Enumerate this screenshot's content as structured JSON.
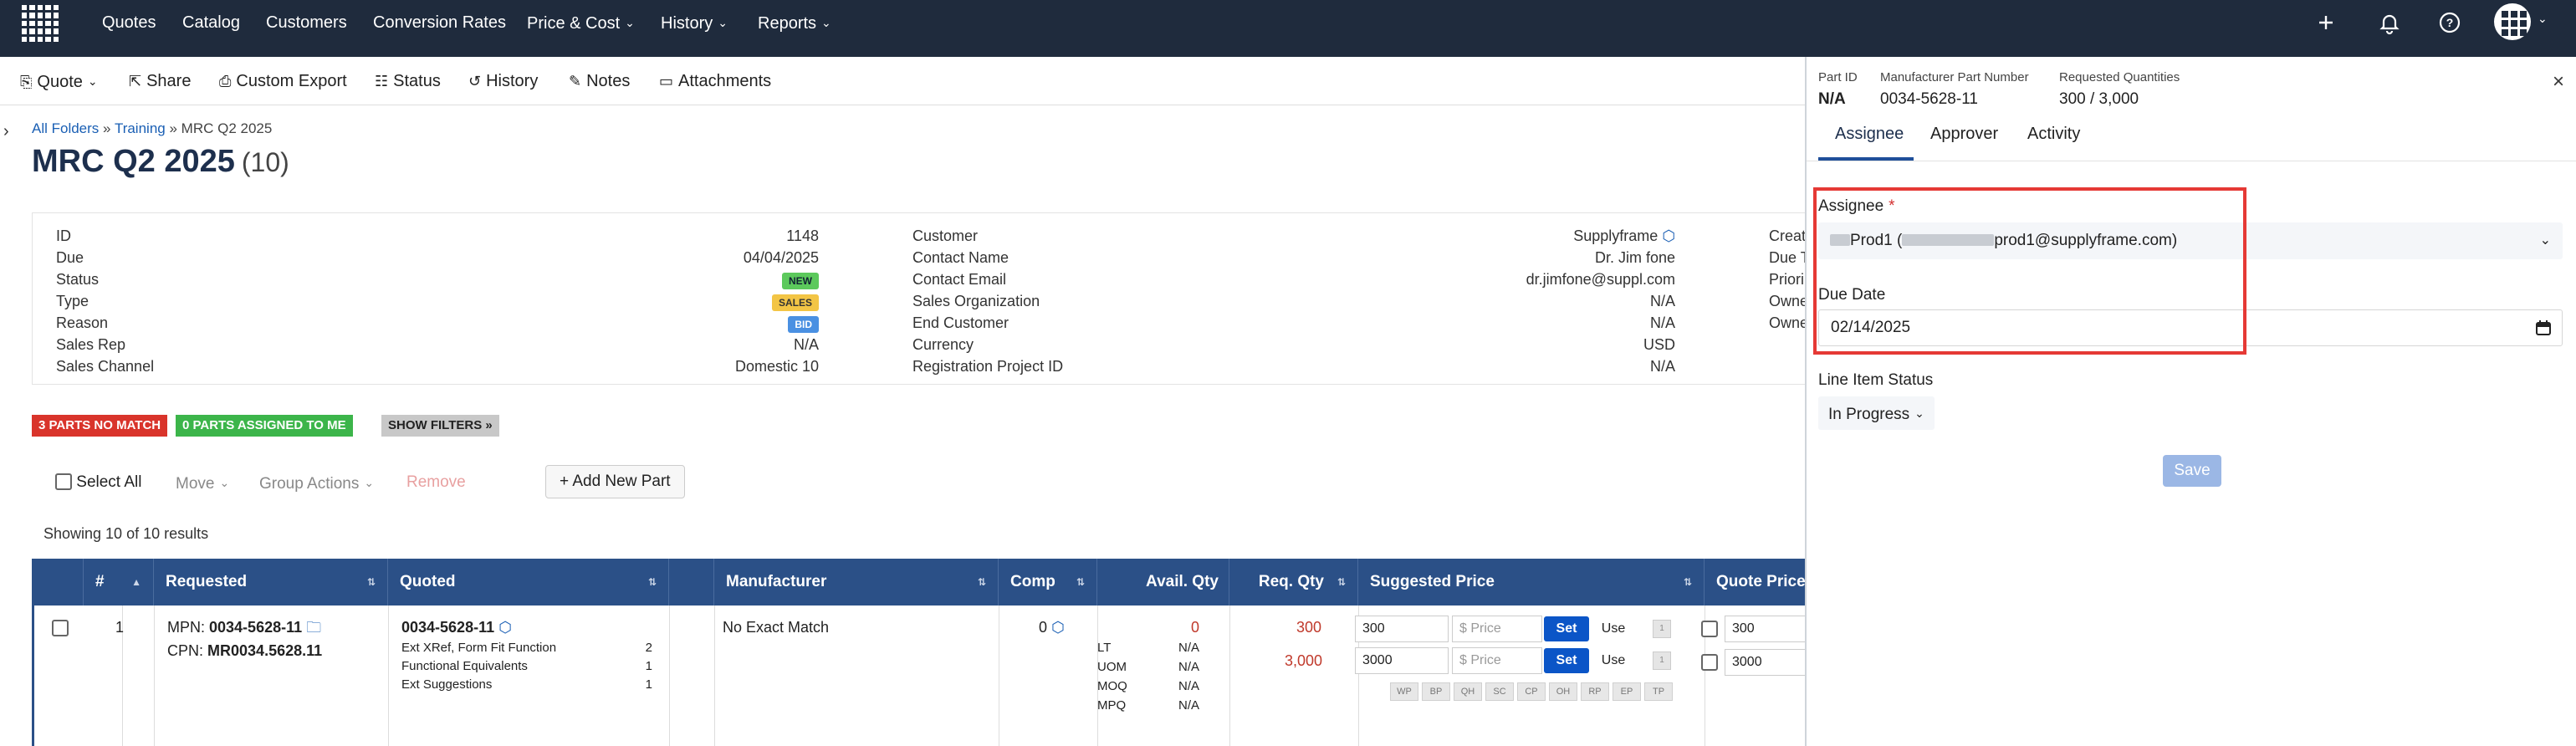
{
  "topnav": {
    "items": [
      "Quotes",
      "Catalog",
      "Customers",
      "Conversion Rates",
      "Price & Cost",
      "History",
      "Reports"
    ],
    "icons": [
      "plus-icon",
      "bell-icon",
      "help-icon",
      "apps-icon"
    ]
  },
  "toolbar": {
    "quote": "Quote",
    "share": "Share",
    "custom_export": "Custom Export",
    "status": "Status",
    "history": "History",
    "notes": "Notes",
    "attachments": "Attachments"
  },
  "breadcrumb": {
    "all_folders": "All Folders",
    "sep": "»",
    "training": "Training",
    "current": "MRC Q2 2025"
  },
  "title": {
    "name": "MRC Q2 2025",
    "count": "(10)"
  },
  "info": {
    "col1": [
      {
        "k": "ID",
        "v": "1148"
      },
      {
        "k": "Due",
        "v": "04/04/2025"
      },
      {
        "k": "Status",
        "v": "NEW"
      },
      {
        "k": "Type",
        "v": "SALES"
      },
      {
        "k": "Reason",
        "v": "BID"
      },
      {
        "k": "Sales Rep",
        "v": "N/A"
      },
      {
        "k": "Sales Channel",
        "v": "Domestic 10"
      }
    ],
    "col2": [
      {
        "k": "Customer",
        "v": "Supplyframe"
      },
      {
        "k": "Contact Name",
        "v": "Dr. Jim fone"
      },
      {
        "k": "Contact Email",
        "v": "dr.jimfone@suppl.com"
      },
      {
        "k": "Sales Organization",
        "v": "N/A"
      },
      {
        "k": "End Customer",
        "v": "N/A"
      },
      {
        "k": "Currency",
        "v": "USD"
      },
      {
        "k": "Registration Project ID",
        "v": "N/A"
      }
    ],
    "col3": [
      "Creat",
      "Due T",
      "Priori",
      "Owne",
      "Owne"
    ]
  },
  "filters": {
    "no_match": "3 PARTS NO MATCH",
    "assigned": "0 PARTS ASSIGNED TO ME",
    "show_filters": "SHOW FILTERS »"
  },
  "actions": {
    "select_all": "Select All",
    "move": "Move",
    "group_actions": "Group Actions",
    "remove": "Remove",
    "add_new_part": "+ Add New Part"
  },
  "showing": "Showing 10 of 10 results",
  "table": {
    "headers": [
      "#",
      "Requested",
      "Quoted",
      "",
      "Manufacturer",
      "Comp",
      "Avail. Qty",
      "Req. Qty",
      "Suggested Price",
      "Quote Price"
    ],
    "row": {
      "num": "1",
      "mpn_label": "MPN:",
      "mpn": "0034-5628-11",
      "cpn_label": "CPN:",
      "cpn": "MR0034.5628.11",
      "quoted": "0034-5628-11",
      "quoted_lines": [
        {
          "k": "Ext XRef, Form Fit Function",
          "v": "2"
        },
        {
          "k": "Functional Equivalents",
          "v": "1"
        },
        {
          "k": "Ext Suggestions",
          "v": "1"
        }
      ],
      "manufacturer": "No Exact Match",
      "comp": "0",
      "avail_qty": "0",
      "avail_lines": [
        {
          "k": "LT",
          "v": "N/A"
        },
        {
          "k": "UOM",
          "v": "N/A"
        },
        {
          "k": "MOQ",
          "v": "N/A"
        },
        {
          "k": "MPQ",
          "v": "N/A"
        }
      ],
      "req_qty": [
        "300",
        "3,000"
      ],
      "suggested": [
        {
          "qty": "300",
          "price_placeholder": "$ Price",
          "set": "Set",
          "use": "Use"
        },
        {
          "qty": "3000",
          "price_placeholder": "$ Price",
          "set": "Set",
          "use": "Use"
        }
      ],
      "price_tags": [
        "WP",
        "BP",
        "QH",
        "SC",
        "CP",
        "OH",
        "RP",
        "EP",
        "TP"
      ],
      "quote_price": [
        "300",
        "3000"
      ]
    }
  },
  "panel": {
    "part_id_label": "Part ID",
    "part_id": "N/A",
    "mpn_label": "Manufacturer Part Number",
    "mpn": "0034-5628-11",
    "req_qty_label": "Requested Quantities",
    "req_qty": "300 / 3,000",
    "tabs": [
      "Assignee",
      "Approver",
      "Activity"
    ],
    "assignee_label": "Assignee",
    "required_mark": "*",
    "assignee_value_a": "Prod1 (",
    "assignee_value_b": "prod1@supplyframe.com)",
    "due_date_label": "Due Date",
    "due_date": "02/14/2025",
    "line_status_label": "Line Item Status",
    "line_status": "In Progress",
    "save": "Save"
  },
  "colors": {
    "nav_bg": "#1f2b3d",
    "table_head": "#2b5087",
    "badge_new": "#5cc95c",
    "badge_sales": "#f3c545",
    "badge_bid": "#4a90e2",
    "no_match": "#d9342b",
    "assigned": "#3cb54a",
    "highlight": "#e53935",
    "set_button": "#0b55c7"
  }
}
